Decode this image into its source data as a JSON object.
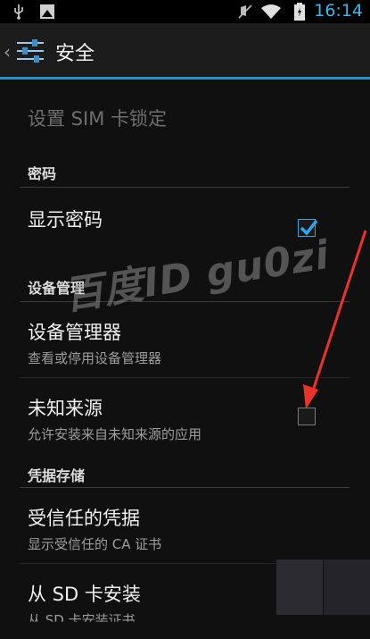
{
  "status_bar": {
    "time": "16:14",
    "left_icons": [
      "usb-icon",
      "image-icon"
    ],
    "right_icons": [
      "mute-icon",
      "wifi-icon",
      "battery-icon"
    ],
    "accent": "#3fb6e8"
  },
  "action_bar": {
    "title": "安全",
    "back_icon": "back-chevron-icon",
    "app_icon": "settings-icon",
    "underline_color": "#2d8fc4"
  },
  "items": {
    "sim_lock": {
      "title": "设置 SIM 卡锁定",
      "enabled": false
    },
    "password_header": "密码",
    "show_password": {
      "title": "显示密码",
      "checked": true
    },
    "device_admin_header": "设备管理",
    "device_admins": {
      "title": "设备管理器",
      "summary": "查看或停用设备管理器"
    },
    "unknown_sources": {
      "title": "未知来源",
      "summary": "允许安装来自未知来源的应用",
      "checked": false
    },
    "credential_header": "凭据存储",
    "trusted_credentials": {
      "title": "受信任的凭据",
      "summary": "显示受信任的 CA 证书"
    },
    "install_from_sd": {
      "title": "从 SD 卡安装",
      "summary": "从 SD 卡安装证书"
    }
  },
  "watermark": "百度ID gu0zi",
  "annotation": {
    "color": "#e8322a",
    "points_to": "unknown_sources.checkbox"
  }
}
